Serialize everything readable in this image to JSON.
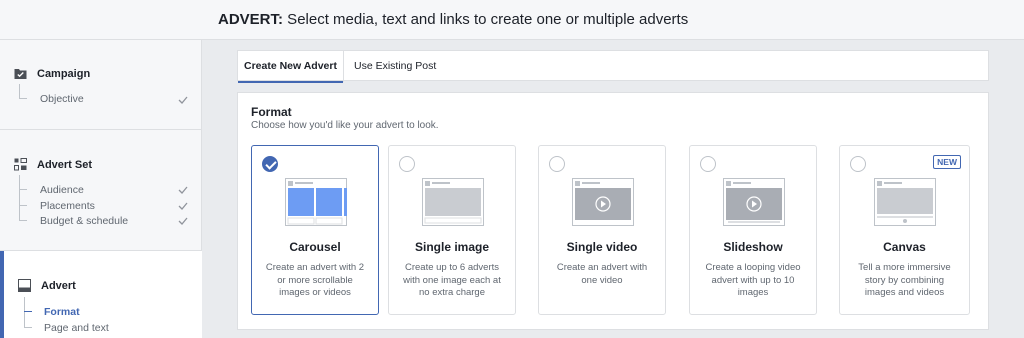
{
  "header": {
    "title_bold": "ADVERT:",
    "title_rest": " Select media, text and links to create one or multiple adverts"
  },
  "sidebar": {
    "campaign": {
      "label": "Campaign",
      "icon": "folder-check-icon",
      "items": [
        "Objective"
      ]
    },
    "advert_set": {
      "label": "Advert Set",
      "icon": "grid-icon",
      "items": [
        "Audience",
        "Placements",
        "Budget & schedule"
      ]
    },
    "advert": {
      "label": "Advert",
      "icon": "advert-icon",
      "items": [
        "Format",
        "Page and text"
      ]
    }
  },
  "tabs": [
    "Create New Advert",
    "Use Existing Post"
  ],
  "format": {
    "title": "Format",
    "subtitle": "Choose how you'd like your advert to look.",
    "cards": [
      {
        "name": "Carousel",
        "desc": "Create an advert with 2 or more scrollable images or videos",
        "selected": true,
        "badge": ""
      },
      {
        "name": "Single image",
        "desc": "Create up to 6 adverts with one image each at no extra charge",
        "selected": false,
        "badge": ""
      },
      {
        "name": "Single video",
        "desc": "Create an advert with one video",
        "selected": false,
        "badge": ""
      },
      {
        "name": "Slideshow",
        "desc": "Create a looping video advert with up to 10 images",
        "selected": false,
        "badge": ""
      },
      {
        "name": "Canvas",
        "desc": "Tell a more immersive story by combining images and videos",
        "selected": false,
        "badge": "NEW"
      }
    ]
  },
  "colors": {
    "accent": "#4267b2",
    "check": "#90949c",
    "border": "#dddfe2"
  }
}
